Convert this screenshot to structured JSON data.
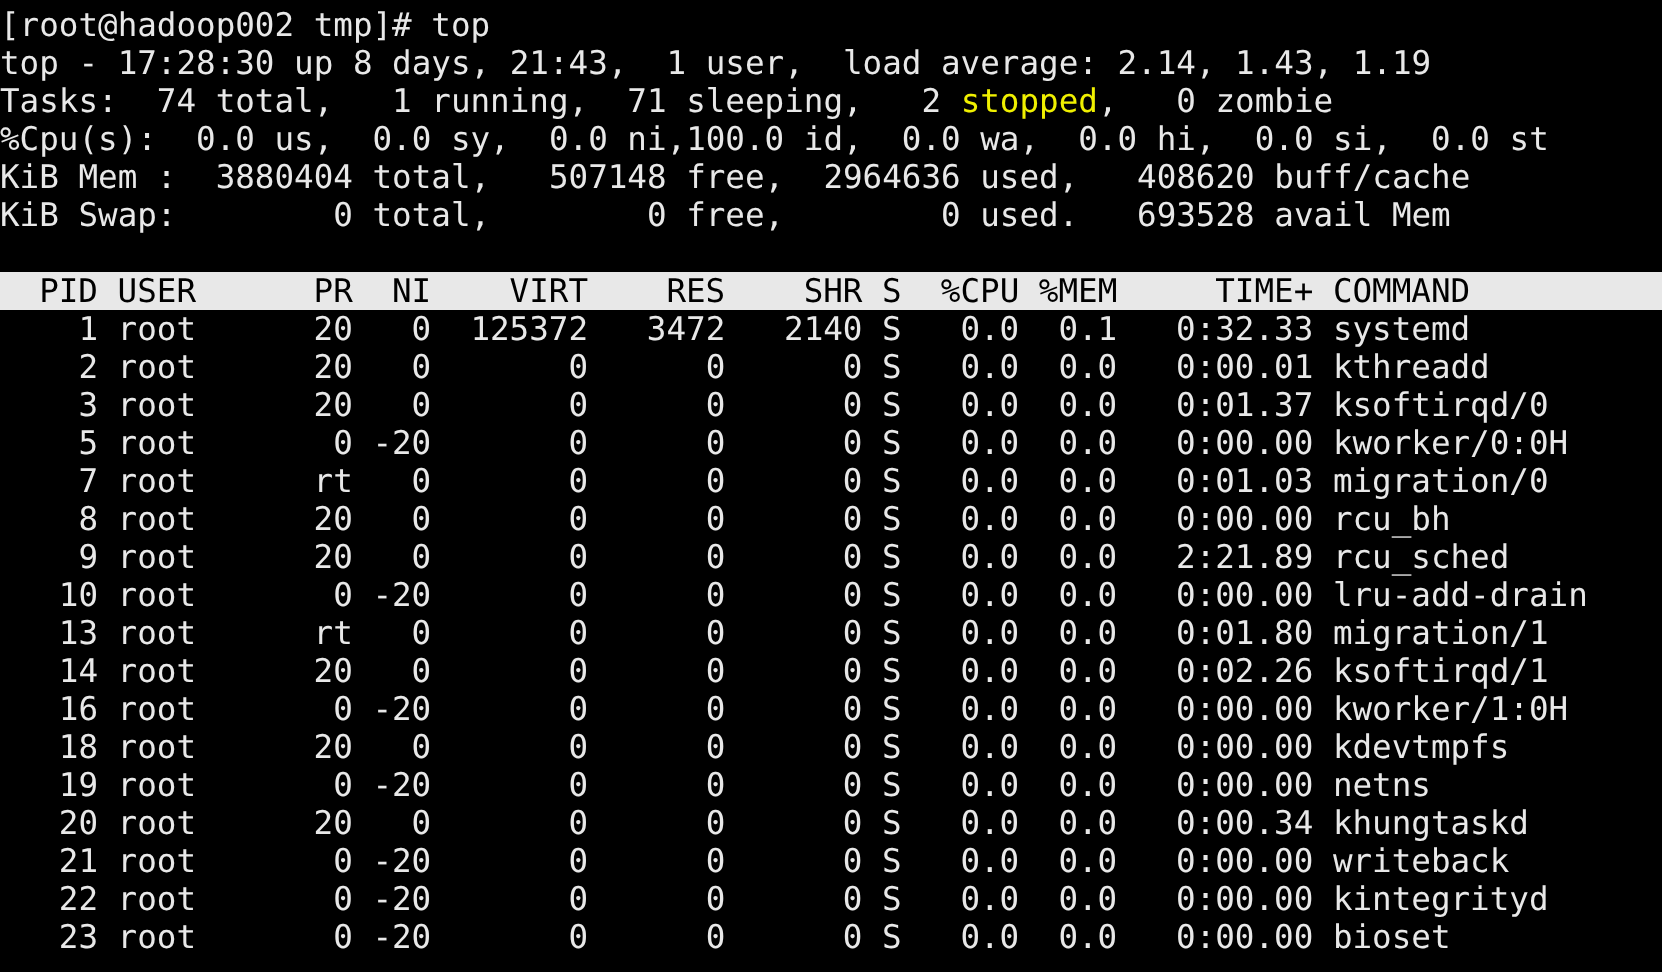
{
  "prompt": "[root@hadoop002 tmp]# top",
  "summary": [
    {
      "parts": [
        {
          "text": "top - 17:28:30 up 8 days, 21:43,  1 user,  load average: 2.14, 1.43, 1.19",
          "highlight": false
        }
      ]
    },
    {
      "parts": [
        {
          "text": "Tasks:  74 total,   1 running,  71 sleeping,   2 ",
          "highlight": false
        },
        {
          "text": "stopped",
          "highlight": true
        },
        {
          "text": ",   0 zombie",
          "highlight": false
        }
      ]
    },
    {
      "parts": [
        {
          "text": "%Cpu(s):  0.0 us,  0.0 sy,  0.0 ni,100.0 id,  0.0 wa,  0.0 hi,  0.0 si,  0.0 st",
          "highlight": false
        }
      ]
    },
    {
      "parts": [
        {
          "text": "KiB Mem :  3880404 total,   507148 free,  2964636 used,   408620 buff/cache",
          "highlight": false
        }
      ]
    },
    {
      "parts": [
        {
          "text": "KiB Swap:        0 total,        0 free,        0 used.   693528 avail Mem",
          "highlight": false
        }
      ]
    }
  ],
  "columns": [
    "PID",
    "USER",
    "PR",
    "NI",
    "VIRT",
    "RES",
    "SHR",
    "S",
    "%CPU",
    "%MEM",
    "TIME+",
    "COMMAND"
  ],
  "rows": [
    [
      "1",
      "root",
      "20",
      "0",
      "125372",
      "3472",
      "2140",
      "S",
      "0.0",
      "0.1",
      "0:32.33",
      "systemd"
    ],
    [
      "2",
      "root",
      "20",
      "0",
      "0",
      "0",
      "0",
      "S",
      "0.0",
      "0.0",
      "0:00.01",
      "kthreadd"
    ],
    [
      "3",
      "root",
      "20",
      "0",
      "0",
      "0",
      "0",
      "S",
      "0.0",
      "0.0",
      "0:01.37",
      "ksoftirqd/0"
    ],
    [
      "5",
      "root",
      "0",
      "-20",
      "0",
      "0",
      "0",
      "S",
      "0.0",
      "0.0",
      "0:00.00",
      "kworker/0:0H"
    ],
    [
      "7",
      "root",
      "rt",
      "0",
      "0",
      "0",
      "0",
      "S",
      "0.0",
      "0.0",
      "0:01.03",
      "migration/0"
    ],
    [
      "8",
      "root",
      "20",
      "0",
      "0",
      "0",
      "0",
      "S",
      "0.0",
      "0.0",
      "0:00.00",
      "rcu_bh"
    ],
    [
      "9",
      "root",
      "20",
      "0",
      "0",
      "0",
      "0",
      "S",
      "0.0",
      "0.0",
      "2:21.89",
      "rcu_sched"
    ],
    [
      "10",
      "root",
      "0",
      "-20",
      "0",
      "0",
      "0",
      "S",
      "0.0",
      "0.0",
      "0:00.00",
      "lru-add-drain"
    ],
    [
      "13",
      "root",
      "rt",
      "0",
      "0",
      "0",
      "0",
      "S",
      "0.0",
      "0.0",
      "0:01.80",
      "migration/1"
    ],
    [
      "14",
      "root",
      "20",
      "0",
      "0",
      "0",
      "0",
      "S",
      "0.0",
      "0.0",
      "0:02.26",
      "ksoftirqd/1"
    ],
    [
      "16",
      "root",
      "0",
      "-20",
      "0",
      "0",
      "0",
      "S",
      "0.0",
      "0.0",
      "0:00.00",
      "kworker/1:0H"
    ],
    [
      "18",
      "root",
      "20",
      "0",
      "0",
      "0",
      "0",
      "S",
      "0.0",
      "0.0",
      "0:00.00",
      "kdevtmpfs"
    ],
    [
      "19",
      "root",
      "0",
      "-20",
      "0",
      "0",
      "0",
      "S",
      "0.0",
      "0.0",
      "0:00.00",
      "netns"
    ],
    [
      "20",
      "root",
      "20",
      "0",
      "0",
      "0",
      "0",
      "S",
      "0.0",
      "0.0",
      "0:00.34",
      "khungtaskd"
    ],
    [
      "21",
      "root",
      "0",
      "-20",
      "0",
      "0",
      "0",
      "S",
      "0.0",
      "0.0",
      "0:00.00",
      "writeback"
    ],
    [
      "22",
      "root",
      "0",
      "-20",
      "0",
      "0",
      "0",
      "S",
      "0.0",
      "0.0",
      "0:00.00",
      "kintegrityd"
    ],
    [
      "23",
      "root",
      "0",
      "-20",
      "0",
      "0",
      "0",
      "S",
      "0.0",
      "0.0",
      "0:00.00",
      "bioset"
    ]
  ]
}
